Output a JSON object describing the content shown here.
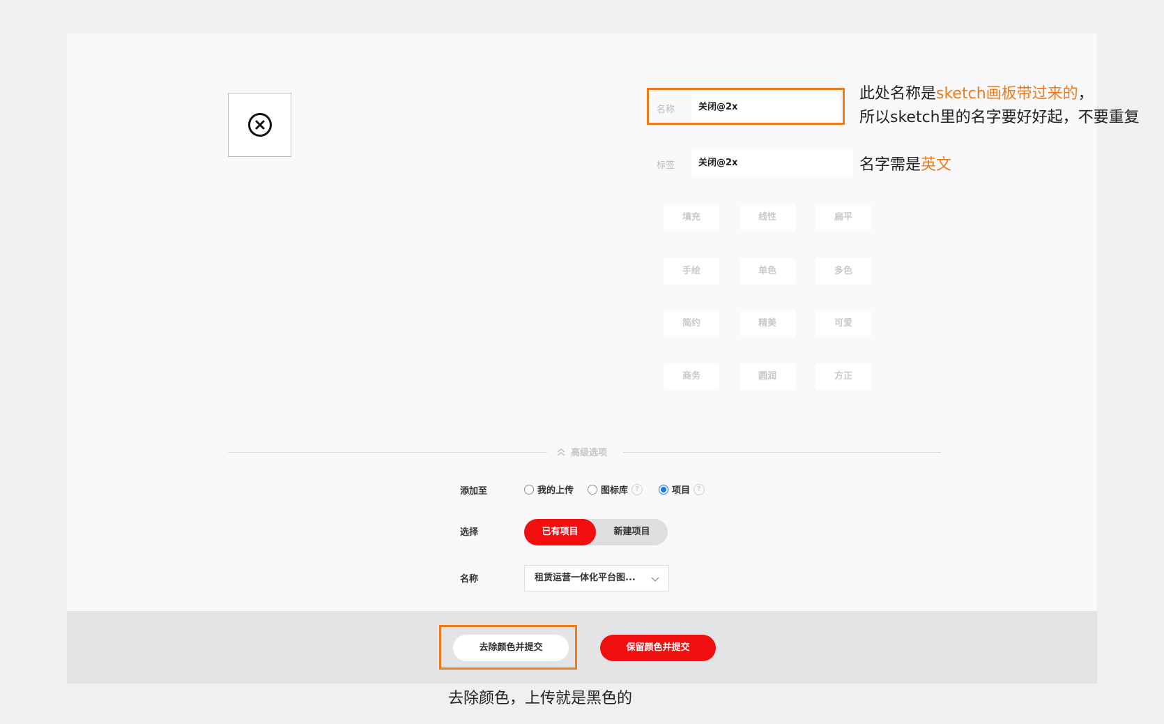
{
  "form": {
    "name_label": "名称",
    "name_value": "关闭@2x",
    "tag_label": "标签",
    "tag_value": "关闭@2x"
  },
  "styles": {
    "row1": [
      "填充",
      "线性",
      "扁平"
    ],
    "row2": [
      "手绘",
      "单色",
      "多色"
    ],
    "row3": [
      "简约",
      "精美",
      "可爱"
    ],
    "row4": [
      "商务",
      "圆润",
      "方正"
    ]
  },
  "advanced": {
    "toggle_label": "高级选项",
    "add_to_label": "添加至",
    "add_to_options": [
      "我的上传",
      "图标库",
      "项目"
    ],
    "add_to_selected": "项目",
    "help_glyph": "?",
    "select_label": "选择",
    "select_options": [
      "已有项目",
      "新建项目"
    ],
    "project_name_label": "名称",
    "project_name_value": "租赁运营一体化平台图..."
  },
  "footer": {
    "remove_color_button": "去除颜色并提交",
    "keep_color_button": "保留颜色并提交"
  },
  "annotations": {
    "note1_prefix": "此处名称是",
    "note1_highlight": "sketch画板带过来的",
    "note1_suffix": "，",
    "note1_line2": "所以sketch里的名字要好好起，不要重复",
    "note2_prefix": "名字需是",
    "note2_highlight": "英文",
    "note3": "去除颜色，上传就是黑色的"
  },
  "colors": {
    "accent_red": "#f00e0e",
    "annotation_orange": "#ef7a1a",
    "radio_blue": "#1a73e8"
  }
}
